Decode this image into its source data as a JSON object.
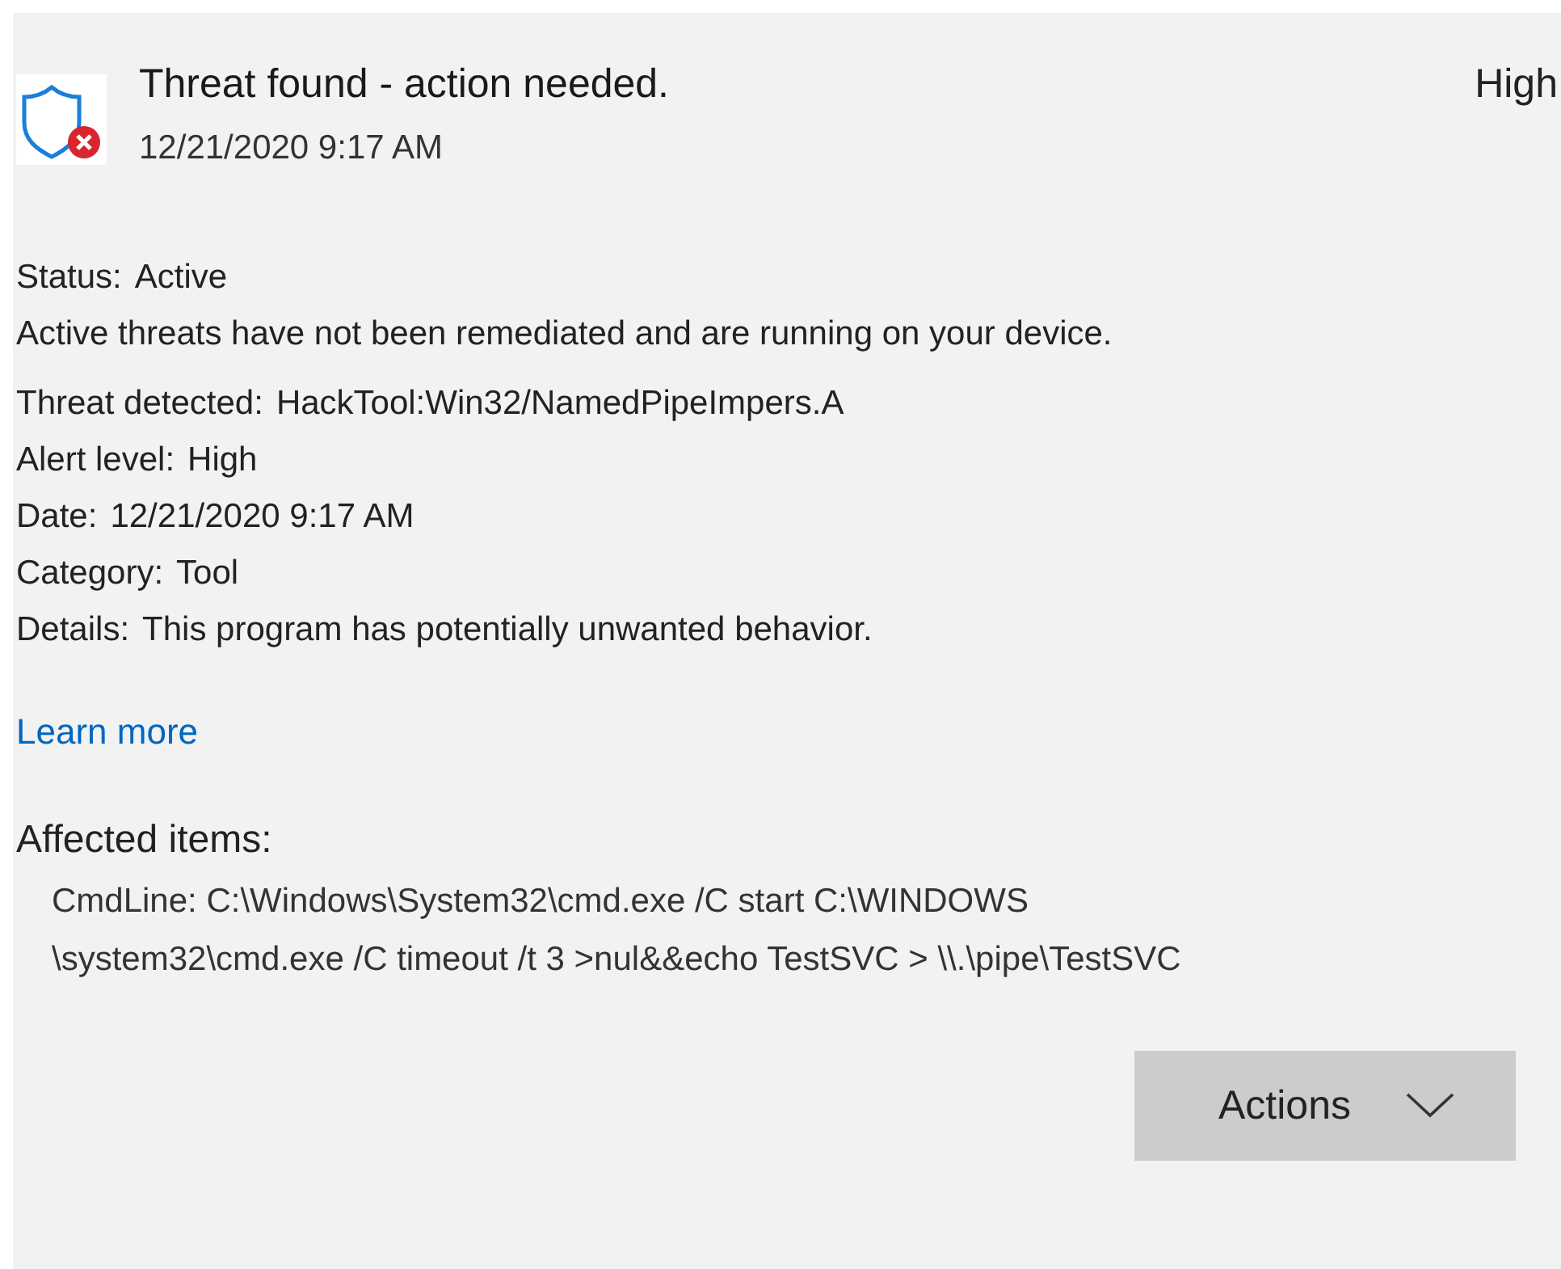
{
  "header": {
    "title": "Threat found - action needed.",
    "date": "12/21/2020 9:17 AM",
    "severity": "High"
  },
  "status": {
    "label": "Status:",
    "value": "Active"
  },
  "status_description": "Active threats have not been remediated and are running on your device.",
  "details": [
    {
      "label": "Threat detected:",
      "value": "HackTool:Win32/NamedPipeImpers.A"
    },
    {
      "label": "Alert level:",
      "value": "High"
    },
    {
      "label": "Date:",
      "value": "12/21/2020 9:17 AM"
    },
    {
      "label": "Category:",
      "value": "Tool"
    },
    {
      "label": "Details:",
      "value": "This program has potentially unwanted behavior."
    }
  ],
  "learn_more": "Learn more",
  "affected_items": {
    "heading": "Affected items:",
    "lines": [
      "CmdLine: C:\\Windows\\System32\\cmd.exe /C start C:\\WINDOWS",
      "\\system32\\cmd.exe /C timeout /t 3 >nul&&echo TestSVC > \\\\.\\pipe\\TestSVC"
    ]
  },
  "actions_button": "Actions"
}
